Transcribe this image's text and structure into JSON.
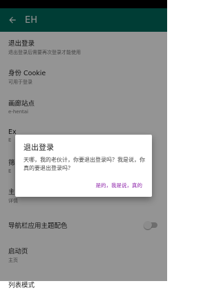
{
  "colors": {
    "appbar": "#00695c",
    "accent": "#8e24aa"
  },
  "appbar": {
    "back_icon": "arrow-back-icon",
    "title": "EH"
  },
  "settings": [
    {
      "title": "退出登录",
      "subtitle": "退出登录后需要再次登录才能使用"
    },
    {
      "title": "身份 Cookie",
      "subtitle": "可用于登录"
    },
    {
      "title": "画廊站点",
      "subtitle": "e-hentai"
    },
    {
      "title": "Ex",
      "subtitle": "E"
    },
    {
      "title": "筛",
      "subtitle": "E"
    },
    {
      "title": "主",
      "subtitle": "详情"
    },
    {
      "title": "导航栏应用主题配色",
      "subtitle": ""
    },
    {
      "title": "启动页",
      "subtitle": "主页"
    },
    {
      "title": "列表模式",
      "subtitle": ""
    }
  ],
  "dialog": {
    "title": "退出登录",
    "message": "天哪，我的老伙计，你要退出登录吗？我是说，你真的要退出登录吗？",
    "confirm": "是的，我是说，真的"
  }
}
